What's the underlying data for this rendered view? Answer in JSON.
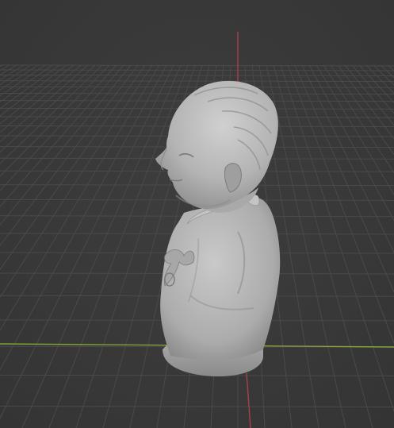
{
  "viewport": {
    "mode": "3d-viewport",
    "background_color": "#393939",
    "grid_color": "#4a4a4a",
    "x_axis_color": "#80a43a",
    "z_axis_color": "#a8414a",
    "object": {
      "name": "bust-sculpture",
      "material_color": "#b9b9b9"
    }
  }
}
